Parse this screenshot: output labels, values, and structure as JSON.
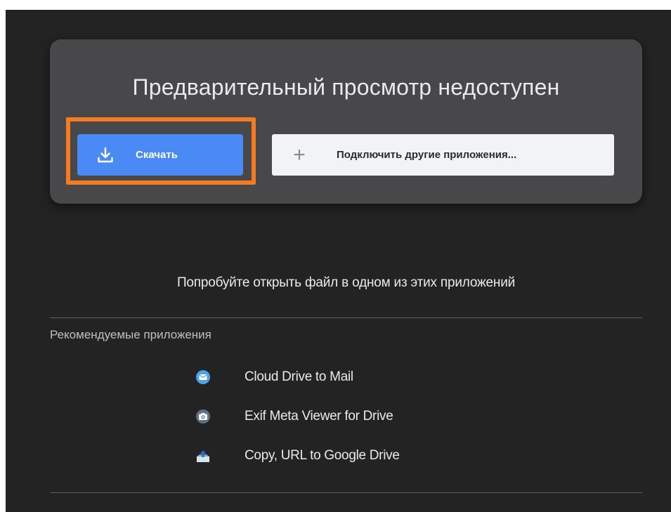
{
  "preview": {
    "title": "Предварительный просмотр недоступен",
    "download_label": "Скачать",
    "download_icon": "download-icon",
    "connect_icon": "plus-icon",
    "connect_label": "Подключить другие приложения...",
    "highlight_color": "#f47b20",
    "download_color": "#4a8af4"
  },
  "suggestions": {
    "prompt": "Попробуйте открыть файл в одном из этих приложений",
    "section_label": "Рекомендуемые приложения",
    "apps": [
      {
        "label": "Cloud Drive to Mail",
        "icon": "mail-icon"
      },
      {
        "label": "Exif Meta Viewer for Drive",
        "icon": "camera-icon"
      },
      {
        "label": "Copy, URL to Google Drive",
        "icon": "cloud-upload-icon"
      }
    ]
  }
}
